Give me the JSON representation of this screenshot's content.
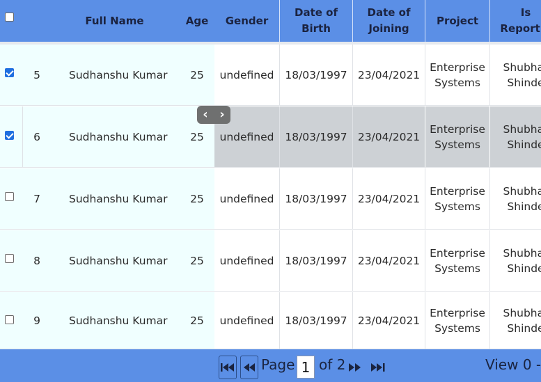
{
  "columns": {
    "full_name": "Full Name",
    "age": "Age",
    "gender": "Gender",
    "dob_line1": "Date of",
    "dob_line2": "Birth",
    "doj_line1": "Date of",
    "doj_line2": "Joining",
    "project": "Project",
    "reporting_line1": "Is",
    "reporting_line2": "Reportin"
  },
  "rows": [
    {
      "id": "5",
      "name": "Sudhanshu Kumar",
      "age": "25",
      "gender": "undefined",
      "dob": "18/03/1997",
      "doj": "23/04/2021",
      "project_line1": "Enterprise",
      "project_line2": "Systems",
      "reporting_line1": "Shubhar",
      "reporting_line2": "Shinde",
      "checked": true
    },
    {
      "id": "6",
      "name": "Sudhanshu Kumar",
      "age": "25",
      "gender": "undefined",
      "dob": "18/03/1997",
      "doj": "23/04/2021",
      "project_line1": "Enterprise",
      "project_line2": "Systems",
      "reporting_line1": "Shubhar",
      "reporting_line2": "Shinde",
      "checked": true
    },
    {
      "id": "7",
      "name": "Sudhanshu Kumar",
      "age": "25",
      "gender": "undefined",
      "dob": "18/03/1997",
      "doj": "23/04/2021",
      "project_line1": "Enterprise",
      "project_line2": "Systems",
      "reporting_line1": "Shubhar",
      "reporting_line2": "Shinde",
      "checked": false
    },
    {
      "id": "8",
      "name": "Sudhanshu Kumar",
      "age": "25",
      "gender": "undefined",
      "dob": "18/03/1997",
      "doj": "23/04/2021",
      "project_line1": "Enterprise",
      "project_line2": "Systems",
      "reporting_line1": "Shubhar",
      "reporting_line2": "Shinde",
      "checked": false
    },
    {
      "id": "9",
      "name": "Sudhanshu Kumar",
      "age": "25",
      "gender": "undefined",
      "dob": "18/03/1997",
      "doj": "23/04/2021",
      "project_line1": "Enterprise",
      "project_line2": "Systems",
      "reporting_line1": "Shubhar",
      "reporting_line2": "Shinde",
      "checked": false
    }
  ],
  "scroller": {
    "left_icon": "chevron-left-icon",
    "right_icon": "chevron-right-icon"
  },
  "pager": {
    "first_icon": "first-page-icon",
    "prev_icon": "previous-page-icon",
    "next_icon": "next-page-icon",
    "last_icon": "last-page-icon",
    "page_label": "Page",
    "current_page": "1",
    "of_label": "of 2",
    "view_text": "View 0 -"
  },
  "colors": {
    "header_bg": "#5b8fe6",
    "frozen_bg": "#f0ffff",
    "selected_row_bg": "#cdd1d5",
    "checkbox_checked": "#1f6fe0"
  }
}
